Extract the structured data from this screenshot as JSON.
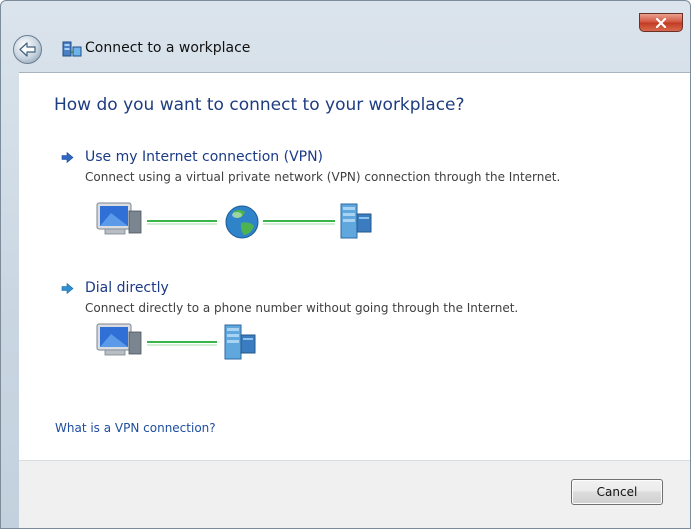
{
  "window": {
    "title": "Connect to a workplace",
    "icons": {
      "back": "back-arrow-icon",
      "title": "network-connection-icon",
      "close": "close-icon"
    }
  },
  "main": {
    "heading": "How do you want to connect to your workplace?",
    "options": [
      {
        "title": "Use my Internet connection (VPN)",
        "description": "Connect using a virtual private network (VPN) connection through the Internet.",
        "diagram_icons": [
          "computer-icon",
          "globe-icon",
          "server-icon"
        ]
      },
      {
        "title": "Dial directly",
        "description": "Connect directly to a phone number without going through the Internet.",
        "diagram_icons": [
          "computer-icon",
          "server-icon"
        ]
      }
    ],
    "help_link": "What is a VPN connection?"
  },
  "footer": {
    "cancel_label": "Cancel"
  },
  "colors": {
    "heading": "#1e3d80",
    "link": "#1e4ea0",
    "connector_line": "#39b54a",
    "close_button": "#c9452c"
  }
}
